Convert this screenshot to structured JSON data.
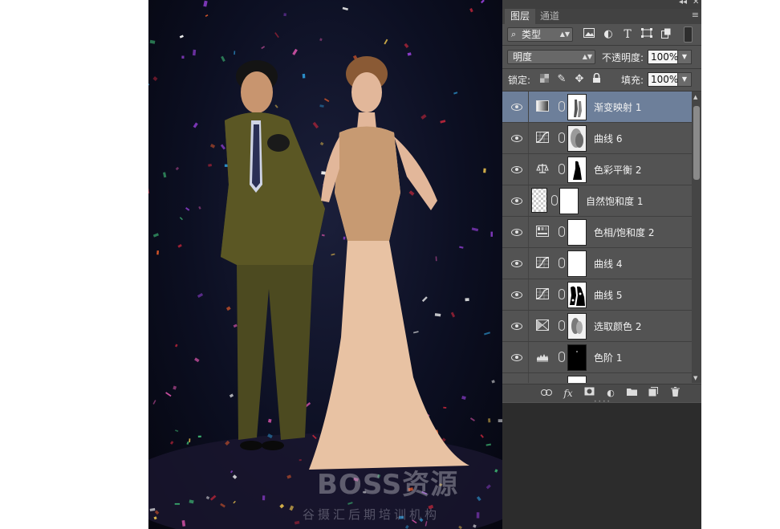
{
  "watermark": {
    "main": "BOSS资源",
    "sub": "谷摄汇后期培训机构"
  },
  "panel": {
    "top_controls": {
      "collapse": "◂◂",
      "close": "✕"
    },
    "tabs": [
      {
        "label": "图层"
      },
      {
        "label": "通道"
      }
    ],
    "menu_icon": "≡",
    "filter": {
      "kind_label": "类型",
      "search_icon": "⌕"
    },
    "blend_mode": "明度",
    "opacity_label": "不透明度:",
    "opacity_value": "100%",
    "lock_label": "锁定:",
    "fill_label": "填充:",
    "fill_value": "100%",
    "layers": [
      {
        "name": "渐变映射 1",
        "adj_icon": "gradient-map-icon",
        "selected": true
      },
      {
        "name": "曲线 6",
        "adj_icon": "curves-icon",
        "selected": false
      },
      {
        "name": "色彩平衡 2",
        "adj_icon": "color-balance-icon",
        "selected": false
      },
      {
        "name": "自然饱和度 1",
        "adj_icon": "vibrance-icon",
        "selected": false
      },
      {
        "name": "色相/饱和度 2",
        "adj_icon": "hue-saturation-icon",
        "selected": false
      },
      {
        "name": "曲线 4",
        "adj_icon": "curves-icon",
        "selected": false
      },
      {
        "name": "曲线 5",
        "adj_icon": "curves-icon",
        "selected": false
      },
      {
        "name": "选取颜色 2",
        "adj_icon": "selective-color-icon",
        "selected": false
      },
      {
        "name": "色阶 1",
        "adj_icon": "levels-icon",
        "selected": false
      }
    ],
    "bottom_icons": [
      "link-icon",
      "fx-icon",
      "add-mask-icon",
      "adjustment-icon",
      "folder-icon",
      "new-layer-icon",
      "trash-icon"
    ],
    "fx_label": "fx",
    "colors": {
      "panel_bg": "#535353",
      "selected_row": "#6d7f9a",
      "dark_bg": "#2c2c2c"
    }
  }
}
